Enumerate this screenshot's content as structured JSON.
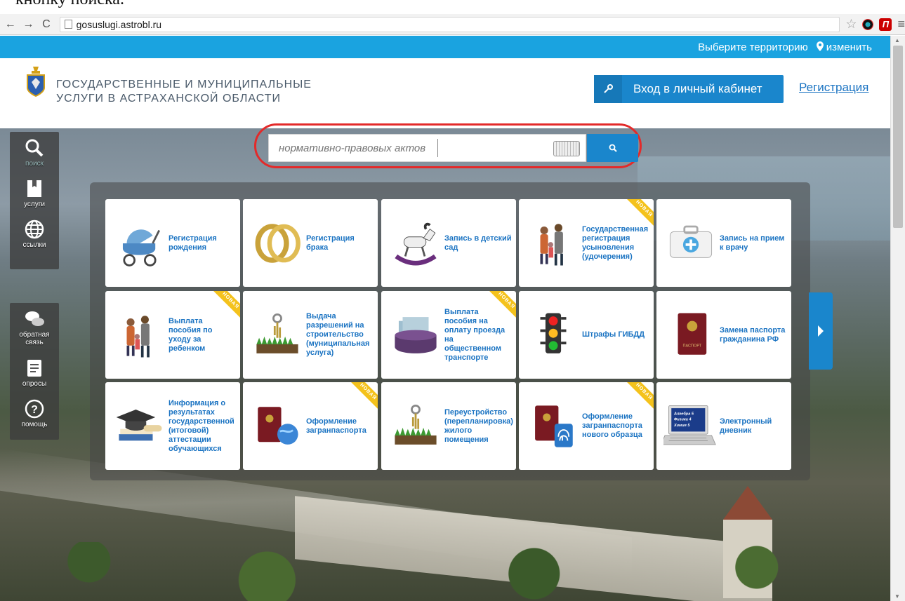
{
  "doc_fragment": "кнопку поиска.",
  "browser": {
    "back_label": "←",
    "forward_label": "→",
    "reload_label": "C",
    "url": "gosuslugi.astrobl.ru",
    "star": "☆",
    "ext_label": "П",
    "menu": "≡"
  },
  "topbar": {
    "territory_label": "Выберите территорию",
    "pin": "⚲",
    "change_label": "изменить"
  },
  "header": {
    "logo_line1": "ГОСУДАРСТВЕННЫЕ И МУНИЦИПАЛЬНЫЕ",
    "logo_line2": "УСЛУГИ В АСТРАХАНСКОЙ ОБЛАСТИ",
    "login_label": "Вход в личный кабинет",
    "register_label": "Регистрация"
  },
  "sidebar": {
    "items": [
      {
        "label": "поиск",
        "icon": "search-icon"
      },
      {
        "label": "услуги",
        "icon": "bookmark-icon"
      },
      {
        "label": "ссылки",
        "icon": "globe-icon"
      },
      {
        "label": "обратная связь",
        "icon": "chat-icon"
      },
      {
        "label": "опросы",
        "icon": "document-icon"
      },
      {
        "label": "помощь",
        "icon": "help-icon"
      }
    ]
  },
  "search": {
    "placeholder": "нормативно-правовых актов"
  },
  "tiles": [
    {
      "label": "Регистрация рождения",
      "icon": "stroller-icon",
      "badge": ""
    },
    {
      "label": "Регистрация брака",
      "icon": "rings-icon",
      "badge": ""
    },
    {
      "label": "Запись в детский сад",
      "icon": "rocking-horse-icon",
      "badge": ""
    },
    {
      "label": "Государственная регистрация усыновления (удочерения)",
      "icon": "family-icon",
      "badge": "НОВАЯ"
    },
    {
      "label": "Запись на прием к врачу",
      "icon": "medkit-icon",
      "badge": ""
    },
    {
      "label": "Выплата пособия по уходу за ребенком",
      "icon": "family-icon",
      "badge": "НОВАЯ"
    },
    {
      "label": "Выдача разрешений на строительство (муниципальная услуга)",
      "icon": "keys-grass-icon",
      "badge": ""
    },
    {
      "label": "Выплата пособия на оплату проезда на общественном транспорте",
      "icon": "wallet-icon",
      "badge": "НОВАЯ"
    },
    {
      "label": "Штрафы ГИБДД",
      "icon": "traffic-light-icon",
      "badge": ""
    },
    {
      "label": "Замена паспорта гражданина РФ",
      "icon": "passport-icon",
      "badge": ""
    },
    {
      "label": "Информация о результатах государственной (итоговой) аттестации обучающихся",
      "icon": "graduation-icon",
      "badge": ""
    },
    {
      "label": "Оформление загранпаспорта",
      "icon": "passport-globe-icon",
      "badge": "НОВАЯ"
    },
    {
      "label": "Переустройство (перепланировка) жилого помещения",
      "icon": "keys-grass-icon",
      "badge": ""
    },
    {
      "label": "Оформление загранпаспорта нового образца",
      "icon": "passport-fingerprint-icon",
      "badge": "НОВАЯ"
    },
    {
      "label": "Электронный дневник",
      "icon": "laptop-icon",
      "badge": ""
    }
  ],
  "laptop_screen": [
    "Алгебра 5",
    "Физика 4",
    "Химия 5"
  ],
  "passport_word": "ПАСПОРТ",
  "colors": {
    "topbar": "#1aa3e0",
    "primary_button": "#1a86cc",
    "link": "#1a73c2",
    "badge": "#f4c21c",
    "highlight_ring": "#e32a2a"
  }
}
